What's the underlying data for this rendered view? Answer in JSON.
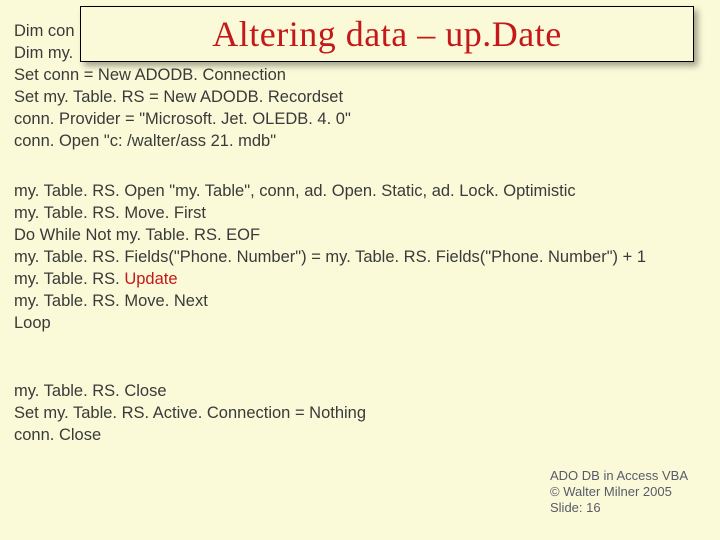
{
  "title": "Altering data – up.Date",
  "code": {
    "block1": [
      "Dim con",
      "Dim my.",
      "Set conn = New ADODB. Connection",
      "Set my. Table. RS = New ADODB. Recordset",
      "conn. Provider = \"Microsoft. Jet. OLEDB. 4. 0\"",
      "conn. Open \"c: /walter/ass 21. mdb\""
    ],
    "block2_pre": "my. Table. RS. Open \"my. Table\", conn, ad. Open. Static, ad. Lock. Optimistic\nmy. Table. RS. Move. First\nDo While Not my. Table. RS. EOF\nmy. Table. RS. Fields(\"Phone. Number\") = my. Table. RS. Fields(\"Phone. Number\") + 1\nmy. Table. RS. ",
    "block2_hl": "Update",
    "block2_post": "\nmy. Table. RS. Move. Next\nLoop",
    "block3": [
      "my. Table. RS. Close",
      "Set my. Table. RS. Active. Connection = Nothing",
      "conn. Close"
    ]
  },
  "footer": {
    "line1": "ADO DB in Access VBA",
    "line2": "© Walter Milner 2005",
    "line3": "Slide: 16"
  }
}
